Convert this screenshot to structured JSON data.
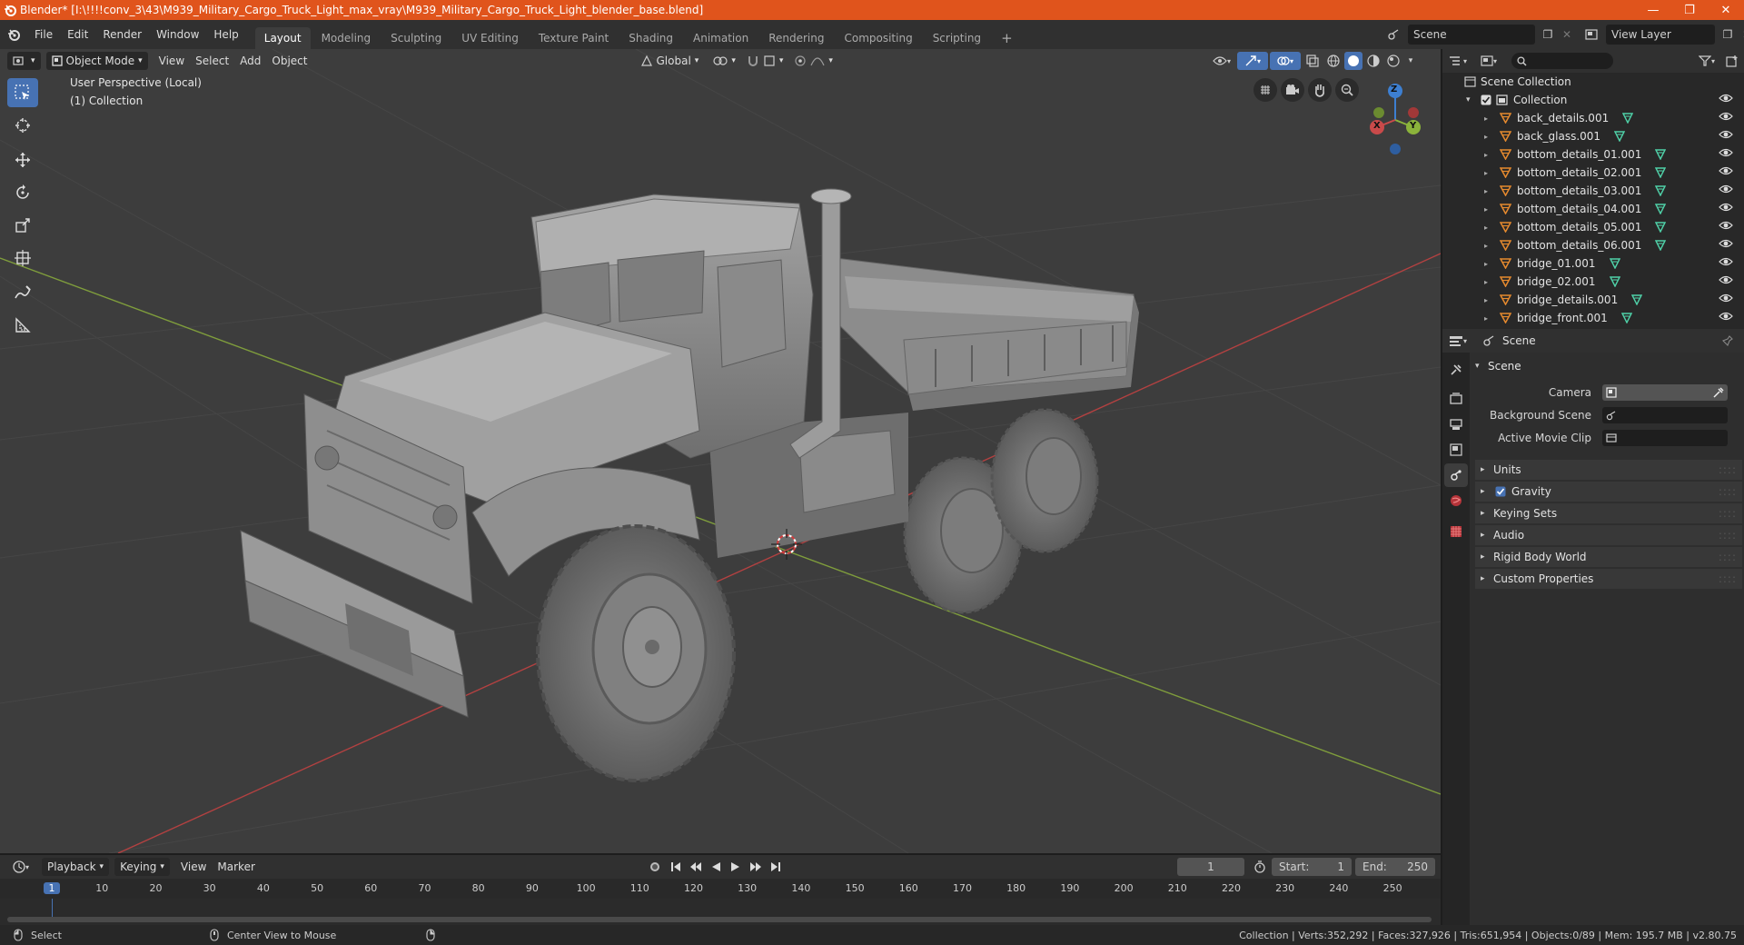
{
  "window": {
    "title": "Blender* [I:\\!!!!conv_3\\43\\M939_Military_Cargo_Truck_Light_max_vray\\M939_Military_Cargo_Truck_Light_blender_base.blend]",
    "accent": "#e0541c"
  },
  "menu": [
    "File",
    "Edit",
    "Render",
    "Window",
    "Help"
  ],
  "workspaces": [
    {
      "label": "Layout",
      "active": true
    },
    {
      "label": "Modeling"
    },
    {
      "label": "Sculpting"
    },
    {
      "label": "UV Editing"
    },
    {
      "label": "Texture Paint"
    },
    {
      "label": "Shading"
    },
    {
      "label": "Animation"
    },
    {
      "label": "Rendering"
    },
    {
      "label": "Compositing"
    },
    {
      "label": "Scripting"
    }
  ],
  "scene_selector": {
    "value": "Scene"
  },
  "view_layer_selector": {
    "value": "View Layer"
  },
  "viewport": {
    "mode": "Object Mode",
    "menus": [
      "View",
      "Select",
      "Add",
      "Object"
    ],
    "transform_orientation": "Global",
    "overlay_title": "User Perspective (Local)",
    "overlay_collection": "(1) Collection",
    "gizmo_labels": {
      "x": "X",
      "y": "Y",
      "z": "Z"
    },
    "colors": {
      "x_axis": "#c94a4a",
      "y_axis": "#8bb33b",
      "z_axis": "#3d7fd1",
      "active_tool": "#4772b3"
    }
  },
  "outliner": {
    "search_placeholder": "",
    "root": "Scene Collection",
    "collection": "Collection",
    "items": [
      "back_details.001",
      "back_glass.001",
      "bottom_details_01.001",
      "bottom_details_02.001",
      "bottom_details_03.001",
      "bottom_details_04.001",
      "bottom_details_05.001",
      "bottom_details_06.001",
      "bridge_01.001",
      "bridge_02.001",
      "bridge_details.001",
      "bridge_front.001"
    ]
  },
  "properties": {
    "context": "Scene",
    "section": "Scene",
    "fields": [
      {
        "label": "Camera",
        "value": ""
      },
      {
        "label": "Background Scene",
        "value": ""
      },
      {
        "label": "Active Movie Clip",
        "value": ""
      }
    ],
    "panels": [
      {
        "label": "Units"
      },
      {
        "label": "Gravity",
        "checkbox": true
      },
      {
        "label": "Keying Sets"
      },
      {
        "label": "Audio"
      },
      {
        "label": "Rigid Body World"
      },
      {
        "label": "Custom Properties"
      }
    ]
  },
  "timeline": {
    "menus": [
      "Playback",
      "Keying",
      "View",
      "Marker"
    ],
    "current_frame": "1",
    "start_label": "Start:",
    "start": "1",
    "end_label": "End:",
    "end": "250",
    "ticks": [
      "1",
      "10",
      "20",
      "30",
      "40",
      "50",
      "60",
      "70",
      "80",
      "90",
      "100",
      "110",
      "120",
      "130",
      "140",
      "150",
      "160",
      "170",
      "180",
      "190",
      "200",
      "210",
      "220",
      "230",
      "240",
      "250"
    ]
  },
  "statusbar": {
    "select": "Select",
    "center_view": "Center View to Mouse",
    "stats": "Collection | Verts:352,292 | Faces:327,926 | Tris:651,954 | Objects:0/89 | Mem: 195.7 MB | v2.80.75"
  }
}
